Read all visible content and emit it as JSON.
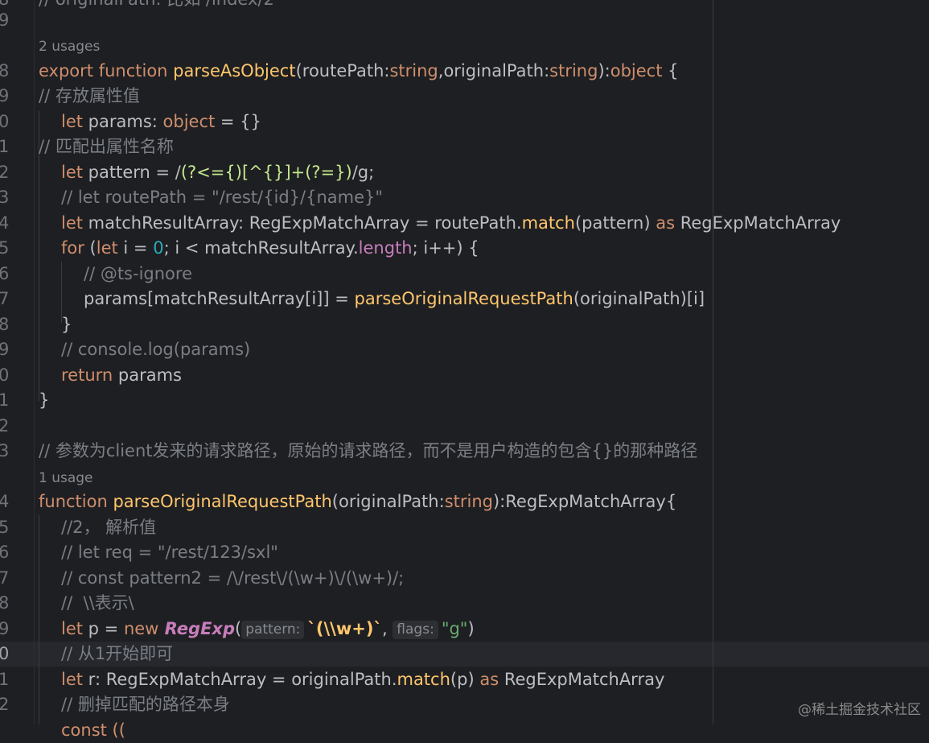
{
  "editor": {
    "gutter": [
      "8",
      "9",
      "0",
      "1",
      "2",
      "3",
      "4",
      "5",
      "6",
      "7",
      "8",
      "9",
      "0",
      "1",
      "2",
      "3",
      "4",
      "5",
      "6",
      "7",
      "8",
      "9",
      "0",
      "1",
      "2"
    ],
    "top_partial": "// originalPath: 比如 /index/2",
    "usages": {
      "first": "2 usages",
      "second": "1 usage"
    },
    "lines": {
      "l8": [
        "export",
        " function",
        " parseAsObject",
        "(routePath:",
        "string",
        ",originalPath:",
        "string",
        "):",
        "object",
        " {"
      ],
      "l9": "// 存放属性值",
      "l10": [
        "let",
        " params: ",
        "object",
        " = {}"
      ],
      "l11": "// 匹配出属性名称",
      "l12": [
        "let",
        " pattern = /",
        "(?<={)[^{}]+(?=})",
        "/g;"
      ],
      "l13": "// let routePath = \"/rest/{id}/{name}\"",
      "l14": [
        "let",
        " matchResultArray: RegExpMatchArray = routePath.",
        "match",
        "(pattern) ",
        "as",
        " RegExpMatchArray"
      ],
      "l15": [
        "for",
        " (",
        "let",
        " i = ",
        "0",
        "; i < matchResultArray.",
        "length",
        "; i++) {"
      ],
      "l16": "// @ts-ignore",
      "l17": [
        "params[matchResultArray[i]] = ",
        "parseOriginalRequestPath",
        "(originalPath)[i]"
      ],
      "l18": "}",
      "l19": "// console.log(params)",
      "l20": [
        "return",
        " params"
      ],
      "l21": "}",
      "l23": "// 参数为client发来的请求路径，原始的请求路径，而不是用户构造的包含{}的那种路径",
      "l24": [
        "function",
        " parseOriginalRequestPath",
        "(originalPath:",
        "string",
        "):RegExpMatchArray{"
      ],
      "l25": "//2， 解析值",
      "l26": "// let req = \"/rest/123/sxl\"",
      "l27": "// const pattern2 = /\\/rest\\/(\\w+)\\/(\\w+)/;",
      "l28": "//  \\\\表示\\",
      "l29": [
        "let",
        " p = ",
        "new",
        " RegExp",
        "(",
        "pattern:",
        "`(\\\\w+)`",
        ", ",
        "flags:",
        "\"g\"",
        ")"
      ],
      "l30": "// 从1开始即可",
      "l31": [
        "let",
        " r: RegExpMatchArray = originalPath.",
        "match",
        "(p) ",
        "as",
        " RegExpMatchArray"
      ],
      "l32": "// 删掉匹配的路径本身",
      "l33": "const (("
    }
  },
  "watermark": "@稀土掘金技术社区",
  "colors": {
    "background": "#1e1f22",
    "keyword": "#cf8e6d",
    "comment": "#7a7e85",
    "function": "#56a8f5",
    "string": "#6aab73",
    "number": "#2aacb8",
    "regex": "#c3e88d"
  }
}
